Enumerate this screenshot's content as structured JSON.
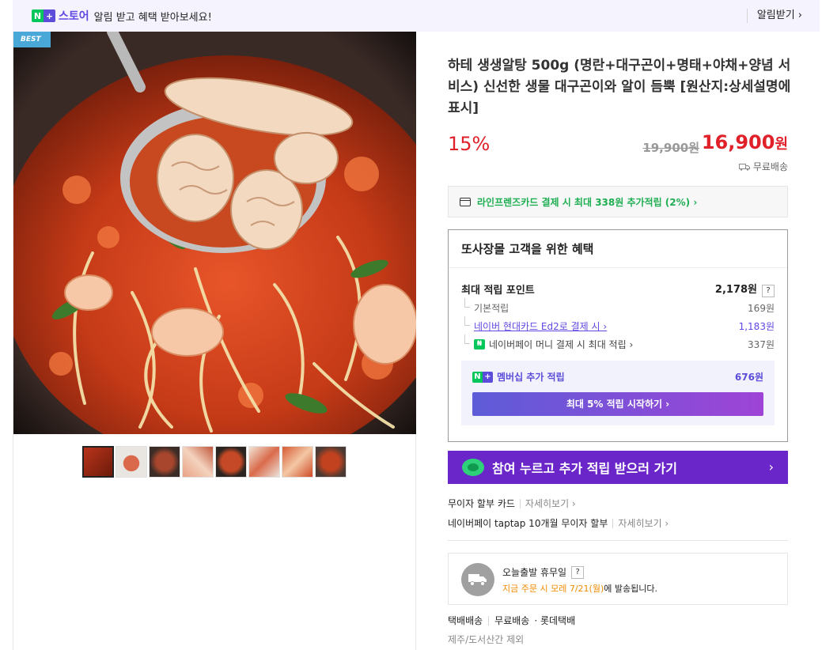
{
  "topbar": {
    "logo_n": "N",
    "logo_plus": "+",
    "store_label": "스토어",
    "message": "알림 받고 혜택 받아보세요!",
    "alarm_button": "알림받기 ›"
  },
  "gallery": {
    "badge": "BEST",
    "thumbnails": [
      {
        "selected": true
      },
      {
        "selected": false
      },
      {
        "selected": false
      },
      {
        "selected": false
      },
      {
        "selected": false
      },
      {
        "selected": false
      },
      {
        "selected": false
      },
      {
        "selected": false
      }
    ]
  },
  "product": {
    "title": "하테 생생알탕 500g (명란+대구곤이+명태+야채+양념 서비스) 신선한 생물 대구곤이와 알이 듬뿍 [원산지:상세설명에 표시]",
    "discount": "15%",
    "original_price": "19,900원",
    "sale_price": "16,900",
    "currency": "원",
    "shipping": "무료배송"
  },
  "card_banner": {
    "text": "라인프렌즈카드 결제 시 최대 338원 추가적립 (2%) ›"
  },
  "benefit": {
    "heading": "또사장몰 고객을 위한 혜택",
    "max_points_label": "최대 적립 포인트",
    "max_points_value": "2,178원",
    "help": "?",
    "rows": [
      {
        "label": "기본적립",
        "value": "169원"
      },
      {
        "label": "네이버 현대카드 Ed2로 결제 시 ›",
        "value": "1,183원"
      },
      {
        "label": "네이버페이 머니 결제 시 최대 적립 ›",
        "value": "337원"
      }
    ],
    "membership_label": "멤버십 추가 적립",
    "membership_value": "676원",
    "membership_button": "최대 5% 적립 시작하기 ›"
  },
  "join_banner": {
    "text": "참여 누르고 추가 적립 받으러 가기",
    "chevron": "›"
  },
  "installments": [
    {
      "label": "무이자 할부 카드",
      "more": "자세히보기 ›"
    },
    {
      "label": "네이버페이 taptap 10개월 무이자 할부",
      "more": "자세히보기 ›"
    }
  ],
  "dispatch": {
    "title": "오늘출발 휴무일",
    "help": "?",
    "order_prefix": "지금 주문 시 모레 ",
    "date": "7/21(월)",
    "order_suffix": "에 발송됩니다."
  },
  "delivery": {
    "method": "택배배송",
    "fee": "무료배송",
    "carrier": "· 롯데택배",
    "note": "제주/도서산간 제외"
  },
  "colors": {
    "price_red": "#e0212a",
    "naver_green": "#03c75a",
    "brand_purple": "#6048e3"
  }
}
